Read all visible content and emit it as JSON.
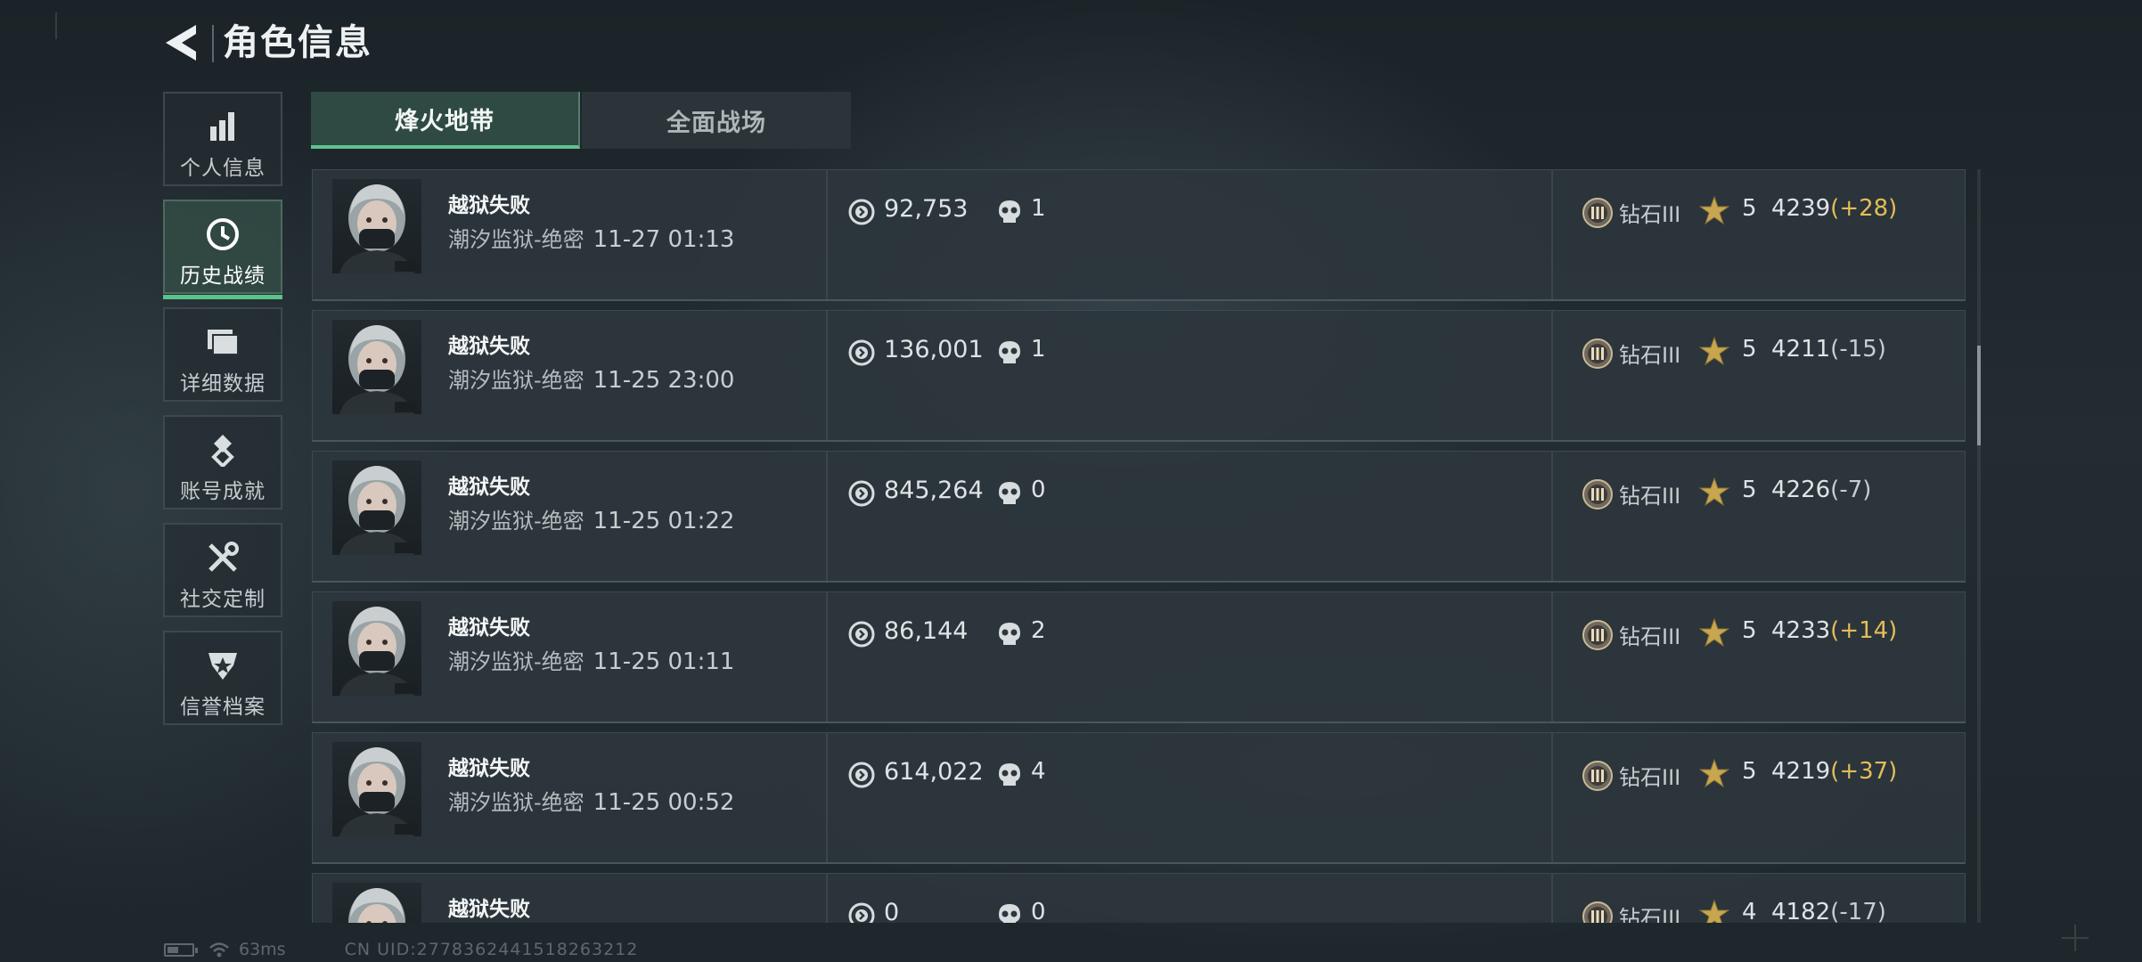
{
  "header": {
    "title": "角色信息",
    "back_icon": "back-arrow-icon"
  },
  "sidebar": {
    "items": [
      {
        "label": "个人信息",
        "icon": "bar-chart-icon",
        "active": false
      },
      {
        "label": "历史战绩",
        "icon": "clock-history-icon",
        "active": true
      },
      {
        "label": "详细数据",
        "icon": "folder-data-icon",
        "active": false
      },
      {
        "label": "账号成就",
        "icon": "medal-achievement-icon",
        "active": false
      },
      {
        "label": "社交定制",
        "icon": "wrench-screwdriver-icon",
        "active": false
      },
      {
        "label": "信誉档案",
        "icon": "shield-badge-icon",
        "active": false
      }
    ]
  },
  "tabs": [
    {
      "label": "烽火地带",
      "active": true
    },
    {
      "label": "全面战场",
      "active": false
    }
  ],
  "matches": [
    {
      "result": "越狱失败",
      "map": "潮汐监狱-绝密",
      "time": "11-27 01:13",
      "money": "92,753",
      "kills": "1",
      "rank": "钻石III",
      "stars": "5",
      "score": "4239",
      "delta": "(+28)",
      "delta_dir": "up"
    },
    {
      "result": "越狱失败",
      "map": "潮汐监狱-绝密",
      "time": "11-25 23:00",
      "money": "136,001",
      "kills": "1",
      "rank": "钻石III",
      "stars": "5",
      "score": "4211",
      "delta": "(-15)",
      "delta_dir": "down"
    },
    {
      "result": "越狱失败",
      "map": "潮汐监狱-绝密",
      "time": "11-25 01:22",
      "money": "845,264",
      "kills": "0",
      "rank": "钻石III",
      "stars": "5",
      "score": "4226",
      "delta": "(-7)",
      "delta_dir": "down"
    },
    {
      "result": "越狱失败",
      "map": "潮汐监狱-绝密",
      "time": "11-25 01:11",
      "money": "86,144",
      "kills": "2",
      "rank": "钻石III",
      "stars": "5",
      "score": "4233",
      "delta": "(+14)",
      "delta_dir": "up"
    },
    {
      "result": "越狱失败",
      "map": "潮汐监狱-绝密",
      "time": "11-25 00:52",
      "money": "614,022",
      "kills": "4",
      "rank": "钻石III",
      "stars": "5",
      "score": "4219",
      "delta": "(+37)",
      "delta_dir": "up"
    },
    {
      "result": "越狱失败",
      "map": "",
      "time": "",
      "money": "0",
      "kills": "0",
      "rank": "钻石III",
      "stars": "4",
      "score": "4182",
      "delta": "(-17)",
      "delta_dir": "down"
    }
  ],
  "status": {
    "ping": "63ms",
    "uid": "CN UID:2778362441518263212"
  },
  "colors": {
    "accent_green": "#59c38c",
    "gain_gold": "#e3bd57",
    "row_bg": "#2c363c",
    "page_bg": "#1e272b"
  }
}
